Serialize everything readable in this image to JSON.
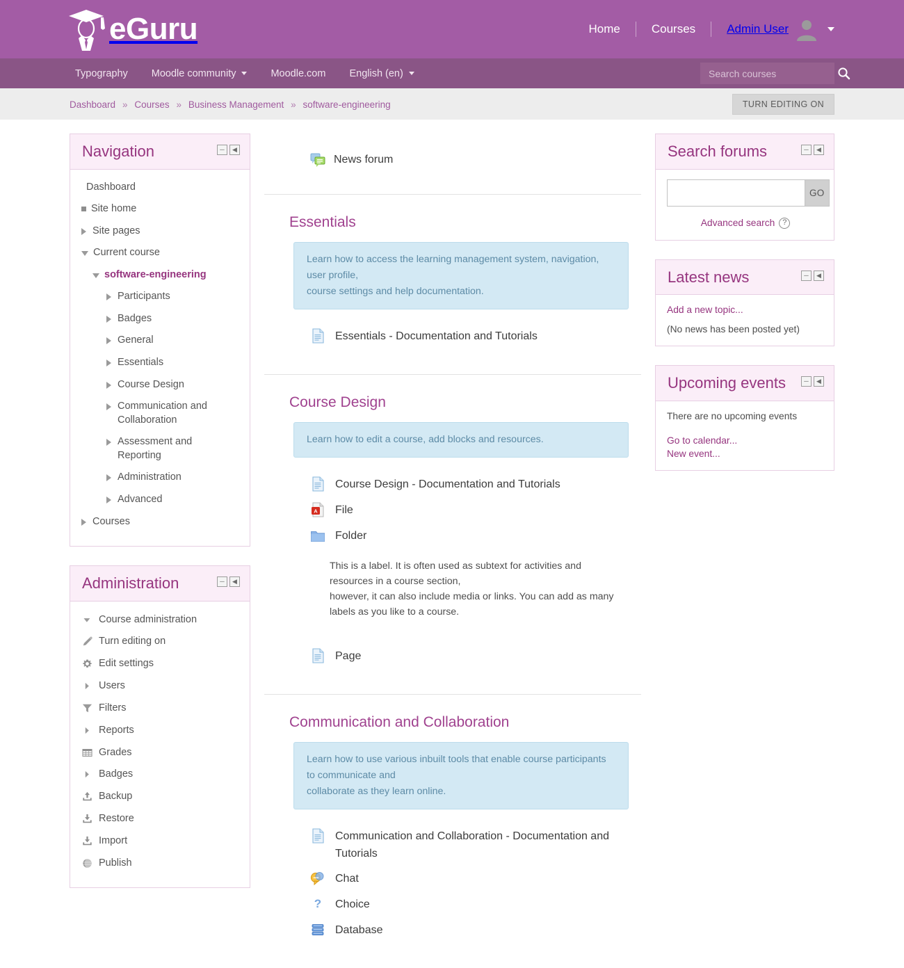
{
  "header": {
    "brand": "eGuru",
    "links": [
      {
        "label": "Home",
        "name": "home"
      },
      {
        "label": "Courses",
        "name": "courses"
      }
    ],
    "user": "Admin User"
  },
  "navbar": {
    "items": [
      {
        "label": "Typography",
        "caret": false
      },
      {
        "label": "Moodle community",
        "caret": true
      },
      {
        "label": "Moodle.com",
        "caret": false
      },
      {
        "label": "English (en)",
        "caret": true
      }
    ],
    "search_placeholder": "Search courses",
    "search_value": ""
  },
  "breadcrumb": {
    "items": [
      "Dashboard",
      "Courses",
      "Business Management",
      "software-engineering"
    ],
    "separator": "»",
    "edit_button": "TURN EDITING ON"
  },
  "blocks": {
    "navigation": {
      "title": "Navigation",
      "items": [
        {
          "label": "Dashboard",
          "pip": "none",
          "indent": 0,
          "current": false
        },
        {
          "label": "Site home",
          "pip": "square",
          "indent": 0,
          "current": false
        },
        {
          "label": "Site pages",
          "pip": "right",
          "indent": 0,
          "current": false
        },
        {
          "label": "Current course",
          "pip": "down",
          "indent": 0,
          "current": false
        },
        {
          "label": "software-engineering",
          "pip": "down",
          "indent": 1,
          "current": true
        },
        {
          "label": "Participants",
          "pip": "right",
          "indent": 2,
          "current": false
        },
        {
          "label": "Badges",
          "pip": "right",
          "indent": 2,
          "current": false
        },
        {
          "label": "General",
          "pip": "right",
          "indent": 2,
          "current": false
        },
        {
          "label": "Essentials",
          "pip": "right",
          "indent": 2,
          "current": false
        },
        {
          "label": "Course Design",
          "pip": "right",
          "indent": 2,
          "current": false
        },
        {
          "label": "Communication and Collaboration",
          "pip": "right",
          "indent": 2,
          "current": false
        },
        {
          "label": "Assessment and Reporting",
          "pip": "right",
          "indent": 2,
          "current": false
        },
        {
          "label": "Administration",
          "pip": "right",
          "indent": 2,
          "current": false
        },
        {
          "label": "Advanced",
          "pip": "right",
          "indent": 2,
          "current": false
        },
        {
          "label": "Courses",
          "pip": "right",
          "indent": 0,
          "current": false
        }
      ]
    },
    "administration": {
      "title": "Administration",
      "items": [
        {
          "label": "Course administration",
          "icon": "caret-down-icon",
          "indent": 0
        },
        {
          "label": "Turn editing on",
          "icon": "pencil-icon",
          "indent": 1
        },
        {
          "label": "Edit settings",
          "icon": "gear-icon",
          "indent": 1
        },
        {
          "label": "Users",
          "icon": "caret-right-icon",
          "indent": 1
        },
        {
          "label": "Filters",
          "icon": "funnel-icon",
          "indent": 1
        },
        {
          "label": "Reports",
          "icon": "caret-right-icon",
          "indent": 1
        },
        {
          "label": "Grades",
          "icon": "table-icon",
          "indent": 1
        },
        {
          "label": "Badges",
          "icon": "caret-right-icon",
          "indent": 1
        },
        {
          "label": "Backup",
          "icon": "upload-icon",
          "indent": 1
        },
        {
          "label": "Restore",
          "icon": "download-icon",
          "indent": 1
        },
        {
          "label": "Import",
          "icon": "download-icon",
          "indent": 1
        },
        {
          "label": "Publish",
          "icon": "globe-icon",
          "indent": 1
        }
      ]
    },
    "search_forums": {
      "title": "Search forums",
      "input_value": "",
      "go_label": "GO",
      "advanced_label": "Advanced search"
    },
    "latest_news": {
      "title": "Latest news",
      "add_topic": "Add a new topic...",
      "empty": "(No news has been posted yet)"
    },
    "upcoming_events": {
      "title": "Upcoming events",
      "empty": "There are no upcoming events",
      "calendar_link": "Go to calendar...",
      "new_event_link": "New event..."
    }
  },
  "main": {
    "news_forum": {
      "label": "News forum",
      "icon": "forum-icon"
    },
    "sections": [
      {
        "title": "Essentials",
        "info": "Learn how to access the learning management system, navigation, user profile,\ncourse settings and help documentation.",
        "resources": [
          {
            "label": "Essentials - Documentation and Tutorials",
            "icon": "page-icon"
          }
        ],
        "label_text": null
      },
      {
        "title": "Course Design",
        "info": "Learn how to edit a course, add blocks and resources.",
        "resources": [
          {
            "label": "Course Design - Documentation and Tutorials",
            "icon": "page-icon"
          },
          {
            "label": "File",
            "icon": "pdf-icon"
          },
          {
            "label": "Folder",
            "icon": "folder-icon"
          }
        ],
        "label_text": "This is a label. It is often used as subtext for activities and resources in a course section,\nhowever, it can also include media or links. You can add as many labels as you like to a course.",
        "resources_after": [
          {
            "label": "Page",
            "icon": "page-icon"
          }
        ]
      },
      {
        "title": "Communication and Collaboration",
        "info": "Learn how to use various inbuilt tools that enable course participants to communicate and\ncollaborate as they learn online.",
        "resources": [
          {
            "label": "Communication and Collaboration - Documentation and Tutorials",
            "icon": "page-icon"
          },
          {
            "label": "Chat",
            "icon": "chat-icon"
          },
          {
            "label": "Choice",
            "icon": "question-icon"
          },
          {
            "label": "Database",
            "icon": "database-icon"
          }
        ],
        "label_text": null
      }
    ]
  },
  "colors": {
    "header": "#a35ca5",
    "navbar": "#8a5586",
    "block_header": "#fbeef8",
    "accent_purple": "#96357f",
    "info_blue": "#d3e9f4"
  }
}
